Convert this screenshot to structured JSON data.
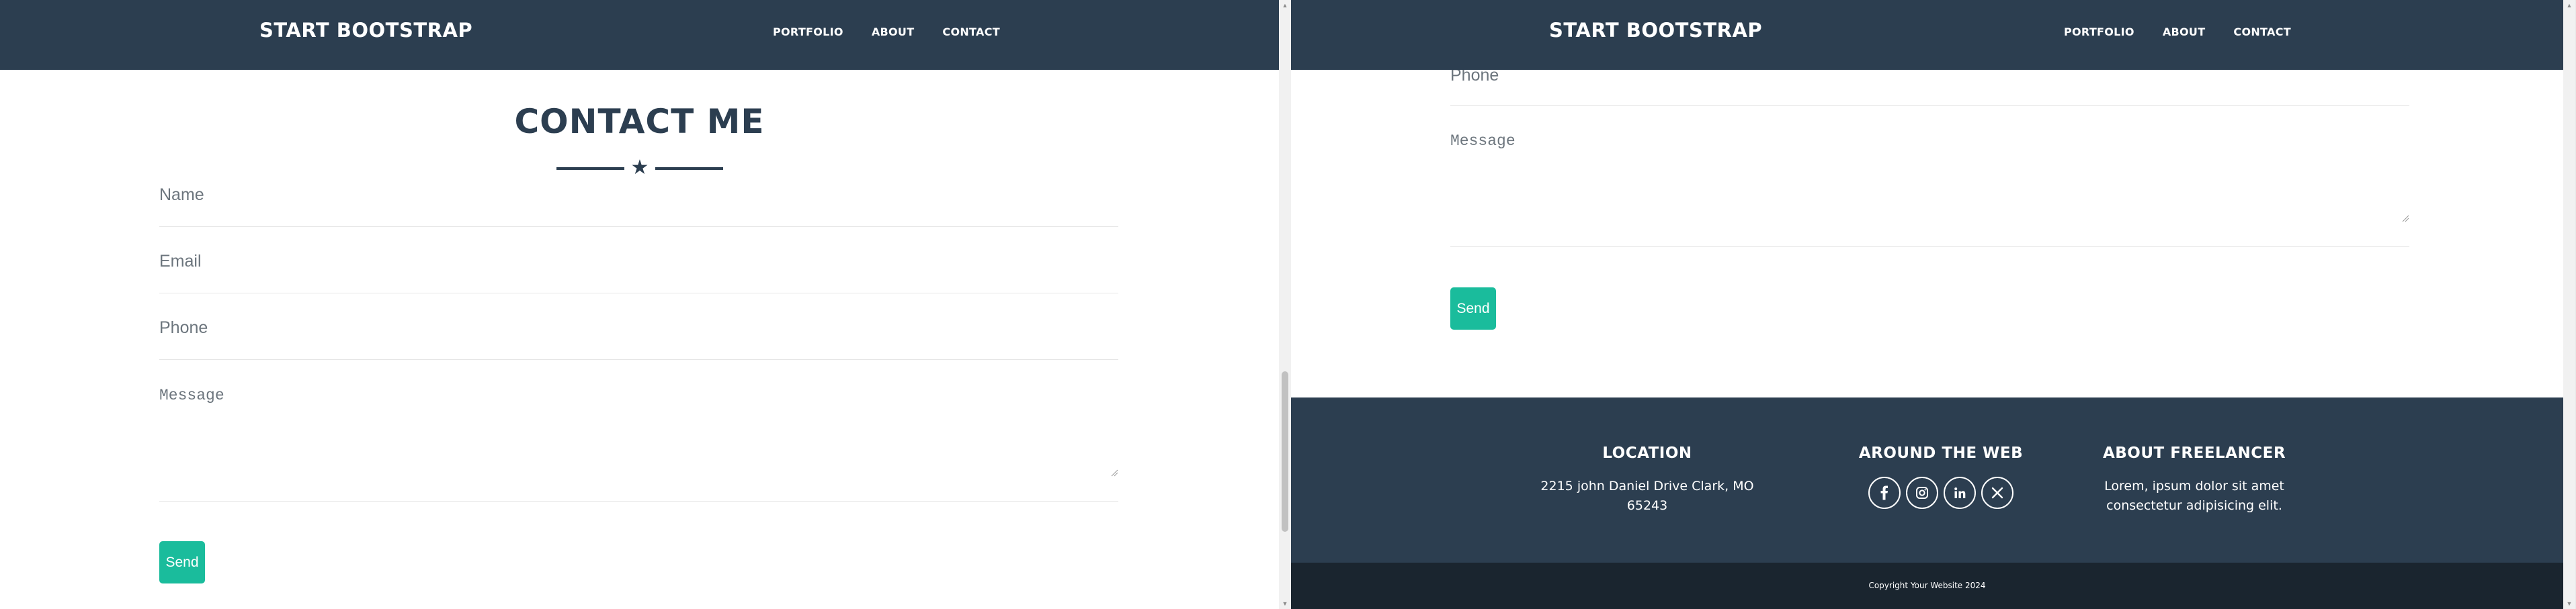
{
  "navbar": {
    "brand": "START BOOTSTRAP",
    "links": [
      "PORTFOLIO",
      "ABOUT",
      "CONTACT"
    ]
  },
  "contact": {
    "title": "CONTACT ME",
    "fields": {
      "name": "Name",
      "email": "Email",
      "phone": "Phone",
      "message": "Message"
    },
    "send_label": "Send"
  },
  "footer": {
    "location": {
      "heading": "LOCATION",
      "address": "2215 john Daniel Drive Clark, MO 65243"
    },
    "web": {
      "heading": "AROUND THE WEB",
      "icons": [
        "facebook-icon",
        "instagram-icon",
        "linkedin-icon",
        "x-twitter-icon"
      ]
    },
    "about": {
      "heading": "ABOUT FREELANCER",
      "text": "Lorem, ipsum dolor sit amet consectetur adipisicing elit."
    },
    "copyright": "Copyright Your Website 2024"
  },
  "colors": {
    "navbar": "#2c3e50",
    "accent": "#1abc9c",
    "footer": "#2c3e50",
    "copyright_bar": "#1a252f"
  }
}
